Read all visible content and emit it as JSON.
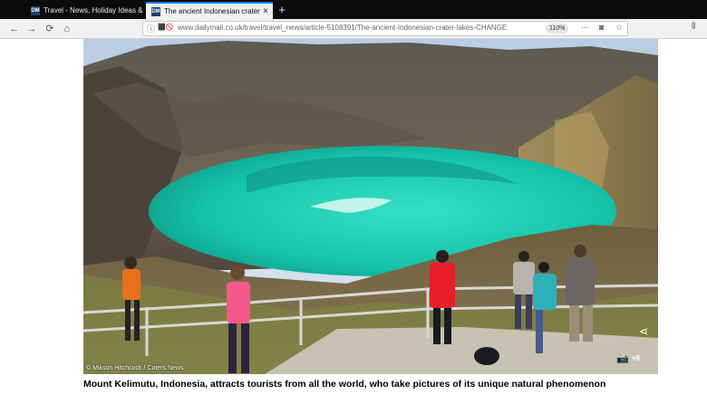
{
  "browser": {
    "tabs": [
      {
        "title": "Travel - News, Holiday Ideas &",
        "favicon": "DM",
        "active": false
      },
      {
        "title": "The ancient Indonesian crater",
        "favicon": "DM",
        "active": true
      }
    ],
    "new_tab_label": "+",
    "close_glyph": "×",
    "nav": {
      "back": "←",
      "forward": "→",
      "reload": "⟳",
      "home": "⌂"
    },
    "url": "www.dailymail.co.uk/travel/travel_news/article-5108391/The-ancient-Indonesian-crater-lakes-CHANGE",
    "info_icon": "ⓘ",
    "permission_icons": "⬛🚫",
    "zoom": "110%",
    "actions": {
      "more": "···",
      "pocket": "◙",
      "bookmark": "☆",
      "library": "⫴"
    }
  },
  "article": {
    "image_credit": "© Mikson Hitchcock / Caters News",
    "share_icon": "⋖",
    "camera_icon": "📷",
    "photo_count": "+8",
    "caption": "Mount Kelimutu, Indonesia, attracts tourists from all the world, who take pictures of its unique natural phenomenon"
  },
  "colors": {
    "lake": "#19c6ad",
    "sky": "#c8d8ea",
    "rock": "#6a5e4f"
  }
}
